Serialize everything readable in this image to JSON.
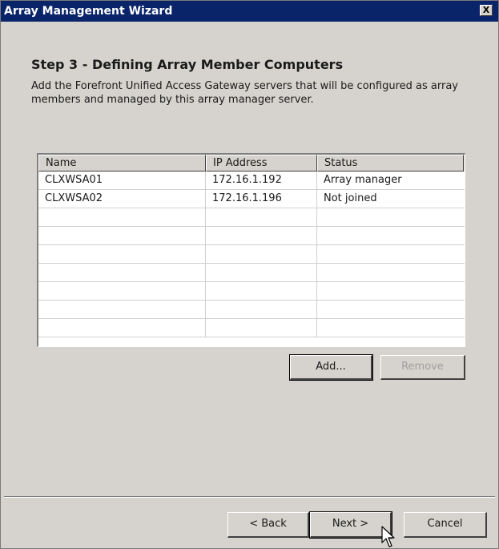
{
  "window": {
    "title": "Array Management Wizard",
    "close_label": "X"
  },
  "step": {
    "heading": "Step 3 - Defining Array Member Computers",
    "description": "Add the Forefront Unified Access Gateway servers that will be configured as array members and managed by this array manager server."
  },
  "members_table": {
    "columns": [
      "Name",
      "IP Address",
      "Status"
    ],
    "rows": [
      {
        "name": "CLXWSA01",
        "ip": "172.16.1.192",
        "status": "Array manager"
      },
      {
        "name": "CLXWSA02",
        "ip": "172.16.1.196",
        "status": "Not joined"
      }
    ]
  },
  "buttons": {
    "add": "Add...",
    "remove": "Remove",
    "back": "< Back",
    "next": "Next >",
    "cancel": "Cancel"
  },
  "colors": {
    "titlebar": "#0a246a",
    "dialog_bg": "#d6d3ce",
    "disabled_text": "#a0a0a0"
  },
  "icons": {
    "close": "close-icon",
    "cursor": "mouse-pointer-icon"
  }
}
